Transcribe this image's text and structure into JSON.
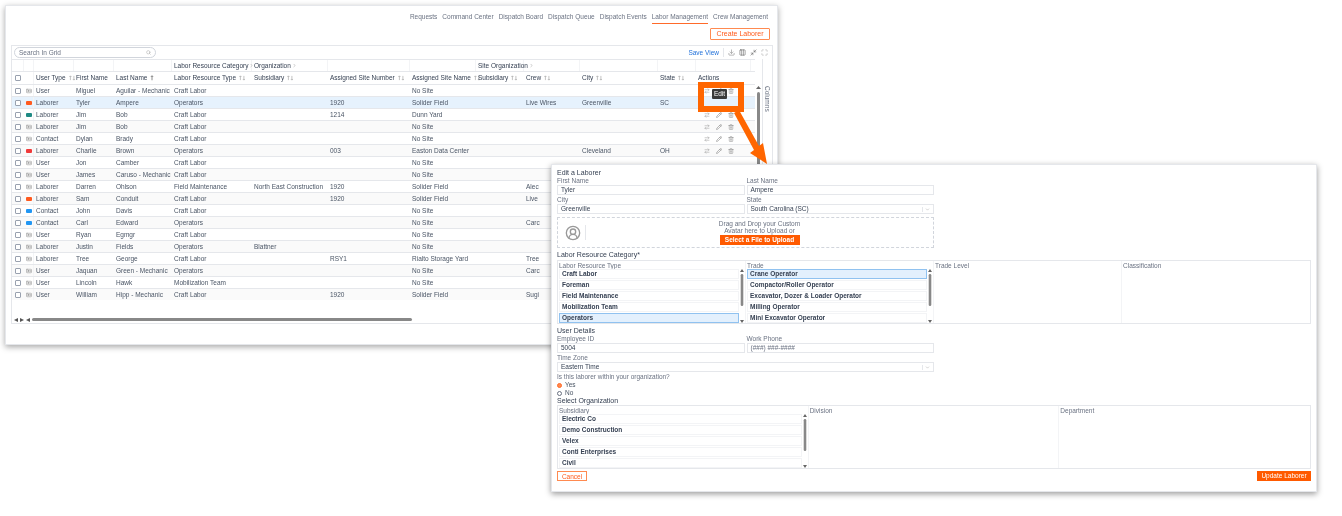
{
  "nav": [
    {
      "label": "Requests",
      "selected": false
    },
    {
      "label": "Command Center",
      "selected": false
    },
    {
      "label": "Dispatch Board",
      "selected": false
    },
    {
      "label": "Dispatch Queue",
      "selected": false
    },
    {
      "label": "Dispatch Events",
      "selected": false
    },
    {
      "label": "Labor Management",
      "selected": true
    },
    {
      "label": "Crew Management",
      "selected": false
    }
  ],
  "create_button": "Create Laborer",
  "grid": {
    "search": {
      "placeholder": "Search In Grid"
    },
    "save_view": "Save View",
    "select_all_checked": false,
    "column_groups": [
      {
        "label": "Labor Resource Category"
      },
      {
        "label": "Organization"
      },
      {
        "label": "Site Organization"
      }
    ],
    "columns": [
      {
        "label": "User Type",
        "sortable": true,
        "sorted": false
      },
      {
        "label": "First Name",
        "sortable": false,
        "sorted": false
      },
      {
        "label": "Last Name",
        "sortable": true,
        "sorted": true
      },
      {
        "label": "Labor Resource Type",
        "sortable": true,
        "sorted": false
      },
      {
        "label": "Subsidiary",
        "sortable": true,
        "sorted": false
      },
      {
        "label": "Assigned Site Number",
        "sortable": true,
        "sorted": false
      },
      {
        "label": "Assigned Site Name",
        "sortable": true,
        "sorted": false
      },
      {
        "label": "Subsidiary",
        "sortable": true,
        "sorted": false
      },
      {
        "label": "Crew",
        "sortable": true,
        "sorted": false
      },
      {
        "label": "City",
        "sortable": true,
        "sorted": false
      },
      {
        "label": "State",
        "sortable": true,
        "sorted": false
      },
      {
        "label": "Actions",
        "sortable": false,
        "sorted": false
      }
    ],
    "rows": [
      {
        "kind": "icon",
        "checked": false,
        "selected": false,
        "actions": true,
        "cells": [
          "User",
          "Miguel",
          "Aguilar - Mechanic",
          "Craft Labor",
          "",
          "",
          "No Site",
          "",
          "",
          "",
          ""
        ]
      },
      {
        "kind": "swatch",
        "color": "#ff5a1f",
        "checked": false,
        "selected": true,
        "actions": false,
        "cells": [
          "Laborer",
          "Tyler",
          "Ampere",
          "Operators",
          "",
          "1920",
          "Solider Field",
          "",
          "Live Wires",
          "Greenville",
          "SC"
        ]
      },
      {
        "kind": "swatch",
        "color": "#1f8a84",
        "checked": false,
        "selected": false,
        "actions": true,
        "cells": [
          "Laborer",
          "Jim",
          "Bob",
          "Craft Labor",
          "",
          "1214",
          "Dunn Yard",
          "",
          "",
          "",
          ""
        ]
      },
      {
        "kind": "icon",
        "checked": false,
        "selected": false,
        "actions": true,
        "cells": [
          "Laborer",
          "Jim",
          "Bob",
          "Craft Labor",
          "",
          "",
          "No Site",
          "",
          "",
          "",
          ""
        ]
      },
      {
        "kind": "icon",
        "checked": false,
        "selected": false,
        "actions": true,
        "cells": [
          "Contact",
          "Dylan",
          "Brady",
          "Craft Labor",
          "",
          "",
          "No Site",
          "",
          "",
          "",
          ""
        ]
      },
      {
        "kind": "swatch",
        "color": "#f03a3a",
        "checked": false,
        "selected": false,
        "actions": true,
        "cells": [
          "Laborer",
          "Charlie",
          "Brown",
          "Operators",
          "",
          "003",
          "Easton Data Center",
          "",
          "",
          "Cleveland",
          "OH"
        ]
      },
      {
        "kind": "icon",
        "checked": false,
        "selected": false,
        "cells": [
          "User",
          "Jon",
          "Camber",
          "Craft Labor",
          "",
          "",
          "No Site",
          "",
          "",
          "",
          ""
        ]
      },
      {
        "kind": "icon",
        "checked": false,
        "selected": false,
        "cells": [
          "User",
          "James",
          "Caruso - Mechanic",
          "Craft Labor",
          "",
          "",
          "No Site",
          "",
          "",
          "",
          ""
        ]
      },
      {
        "kind": "icon",
        "checked": false,
        "selected": false,
        "cells": [
          "Laborer",
          "Darren",
          "Ohlson",
          "Field Maintenance",
          "North East Construction",
          "1920",
          "Solider Field",
          "",
          "Alec",
          "",
          ""
        ]
      },
      {
        "kind": "swatch",
        "color": "#ff5a1f",
        "checked": false,
        "selected": false,
        "cells": [
          "Laborer",
          "Sam",
          "Conduit",
          "Craft Labor",
          "",
          "1920",
          "Solider Field",
          "",
          "Live",
          "",
          ""
        ]
      },
      {
        "kind": "swatch",
        "color": "#2196f3",
        "checked": false,
        "selected": false,
        "cells": [
          "Contact",
          "John",
          "Davis",
          "Craft Labor",
          "",
          "",
          "No Site",
          "",
          "",
          "",
          ""
        ]
      },
      {
        "kind": "swatch",
        "color": "#2196f3",
        "checked": false,
        "selected": false,
        "cells": [
          "Contact",
          "Carl",
          "Edward",
          "Operators",
          "",
          "",
          "No Site",
          "",
          "Carc",
          "",
          ""
        ]
      },
      {
        "kind": "icon",
        "checked": false,
        "selected": false,
        "cells": [
          "User",
          "Ryan",
          "Egmgr",
          "Craft Labor",
          "",
          "",
          "No Site",
          "",
          "",
          "",
          ""
        ]
      },
      {
        "kind": "icon",
        "checked": false,
        "selected": false,
        "cells": [
          "Laborer",
          "Justin",
          "Fields",
          "Operators",
          "Blattner",
          "",
          "No Site",
          "",
          "",
          "",
          ""
        ]
      },
      {
        "kind": "icon",
        "checked": false,
        "selected": false,
        "cells": [
          "Laborer",
          "Tree",
          "George",
          "Craft Labor",
          "",
          "RSY1",
          "Rialto Storage Yard",
          "",
          "Tree",
          "",
          ""
        ]
      },
      {
        "kind": "icon",
        "checked": false,
        "selected": false,
        "cells": [
          "User",
          "Jaquan",
          "Green - Mechanic",
          "Operators",
          "",
          "",
          "No Site",
          "",
          "Carc",
          "",
          ""
        ]
      },
      {
        "kind": "icon",
        "checked": false,
        "selected": false,
        "cells": [
          "User",
          "Lincoln",
          "Hawk",
          "Mobilization Team",
          "",
          "",
          "No Site",
          "",
          "",
          "",
          ""
        ]
      },
      {
        "kind": "icon",
        "checked": false,
        "selected": false,
        "cells": [
          "User",
          "William",
          "Hipp - Mechanic",
          "Craft Labor",
          "",
          "1920",
          "Solider Field",
          "",
          "Sugi",
          "",
          ""
        ]
      }
    ],
    "tooltip": "Edit",
    "side_panel": "Columns"
  },
  "dialog": {
    "title": "Edit a Laborer",
    "fields": [
      {
        "label": "First Name",
        "value": "Tyler",
        "kind": "text"
      },
      {
        "label": "Last Name",
        "value": "Ampere",
        "kind": "text"
      },
      {
        "label": "City",
        "value": "Greenville",
        "kind": "text"
      },
      {
        "label": "State",
        "value": "South Carolina (SC)",
        "kind": "select"
      }
    ],
    "upload": {
      "prompt": "Drag and Drop your Custom Avatar here to Upload or",
      "button": "Select a File to Upload"
    },
    "category": {
      "heading": "Labor Resource Category*",
      "lists": [
        {
          "label": "Labor Resource Type",
          "items": [
            {
              "label": "Craft Labor",
              "selected": false
            },
            {
              "label": "Foreman",
              "selected": false
            },
            {
              "label": "Field Maintenance",
              "selected": false
            },
            {
              "label": "Mobilization Team",
              "selected": false
            },
            {
              "label": "Operators",
              "selected": true
            }
          ]
        },
        {
          "label": "Trade",
          "items": [
            {
              "label": "Crane Operator",
              "selected": true
            },
            {
              "label": "Compactor/Roller Operator",
              "selected": false
            },
            {
              "label": "Excavator, Dozer & Loader Operator",
              "selected": false
            },
            {
              "label": "Milling Operator",
              "selected": false
            },
            {
              "label": "Mini Excavator Operator",
              "selected": false
            }
          ]
        },
        {
          "label": "Trade Level"
        },
        {
          "label": "Classification"
        }
      ]
    },
    "user_details": {
      "heading": "User Details",
      "fields": [
        {
          "label": "Employee ID",
          "value": "5004",
          "kind": "text"
        },
        {
          "label": "Work Phone",
          "placeholder": "(###) ###-####",
          "kind": "text"
        },
        {
          "label": "Time Zone",
          "value": "Eastern Time",
          "kind": "select"
        }
      ],
      "question": "Is this laborer within your organization?",
      "options": [
        {
          "label": "Yes",
          "selected": true
        },
        {
          "label": "No",
          "selected": false
        }
      ]
    },
    "organization": {
      "heading": "Select Organization",
      "lists": [
        {
          "label": "Subsidiary",
          "items": [
            {
              "label": "Electric Co",
              "selected": false
            },
            {
              "label": "Demo Construction",
              "selected": false
            },
            {
              "label": "Velex",
              "selected": false
            },
            {
              "label": "Conti Enterprises",
              "selected": false
            },
            {
              "label": "Civil",
              "selected": false
            }
          ]
        },
        {
          "label": "Division"
        },
        {
          "label": "Department"
        }
      ]
    },
    "cancel": "Cancel",
    "submit": "Update Laborer"
  }
}
